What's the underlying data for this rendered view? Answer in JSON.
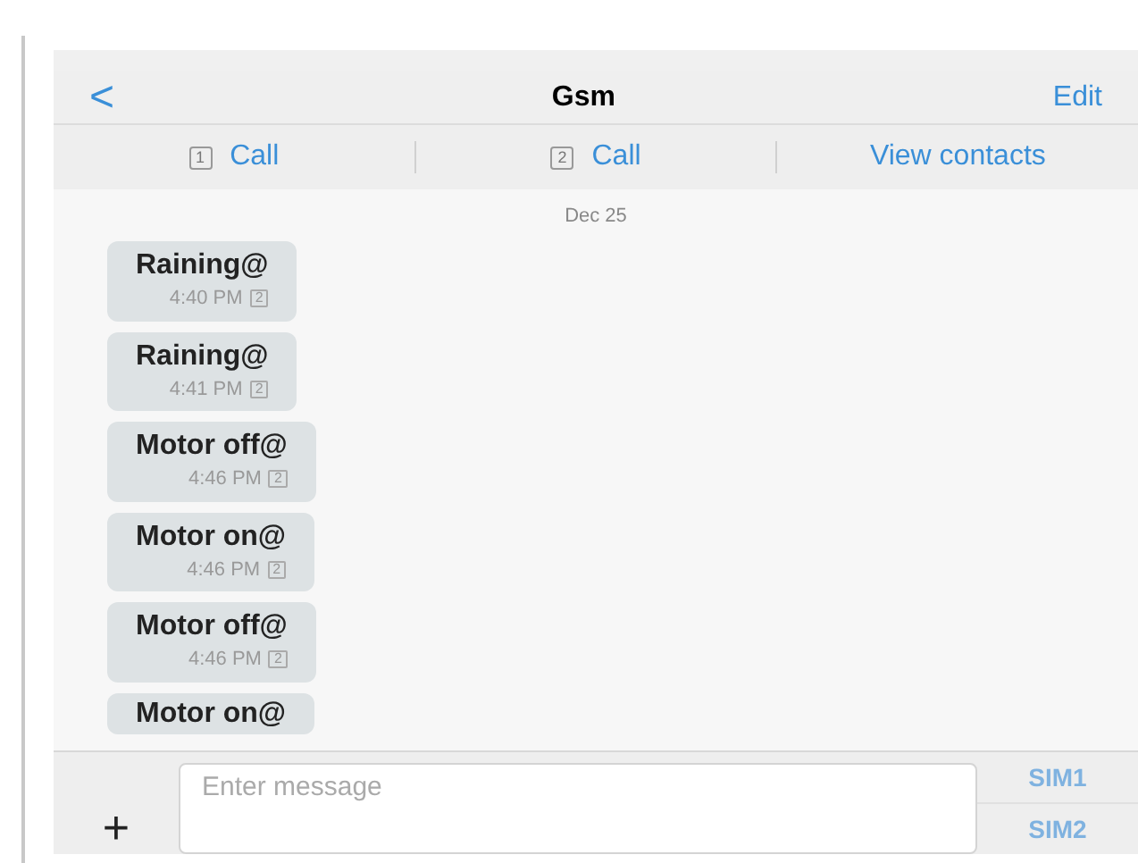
{
  "nav": {
    "back": "<",
    "title": "Gsm",
    "edit": "Edit"
  },
  "actions": [
    {
      "kind": "call",
      "sim": "1",
      "label": "Call"
    },
    {
      "kind": "call",
      "sim": "2",
      "label": "Call"
    },
    {
      "kind": "link",
      "label": "View contacts"
    }
  ],
  "date": "Dec 25",
  "messages": [
    {
      "text": "Raining@",
      "time": "4:40 PM",
      "sim": "2"
    },
    {
      "text": "Raining@",
      "time": "4:41 PM",
      "sim": "2"
    },
    {
      "text": "Motor off@",
      "time": "4:46 PM",
      "sim": "2"
    },
    {
      "text": "Motor on@",
      "time": "4:46 PM",
      "sim": "2"
    },
    {
      "text": "Motor off@",
      "time": "4:46 PM",
      "sim": "2"
    },
    {
      "text": "Motor on@"
    }
  ],
  "composer": {
    "add": "+",
    "placeholder": "Enter message",
    "send_buttons": [
      "SIM1",
      "SIM2"
    ]
  }
}
